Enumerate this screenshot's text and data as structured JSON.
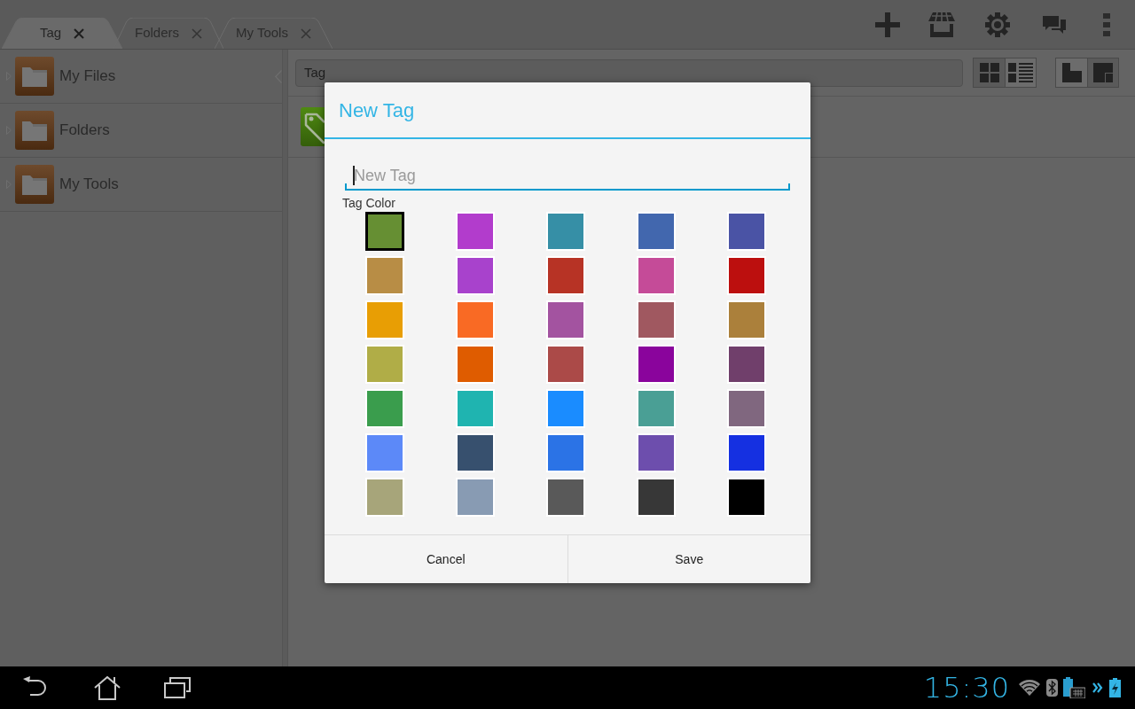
{
  "tabs": [
    {
      "label": "Tag",
      "selected": true
    },
    {
      "label": "Folders",
      "selected": false
    },
    {
      "label": "My Tools",
      "selected": false
    }
  ],
  "sidebar": {
    "items": [
      {
        "label": "My Files",
        "expanded": false
      },
      {
        "label": "Folders",
        "expanded": false
      },
      {
        "label": "My Tools",
        "expanded": false
      }
    ]
  },
  "search": {
    "value": "Tag"
  },
  "view_modes": [
    {
      "kind": "grid",
      "selected": false
    },
    {
      "kind": "list",
      "selected": true
    }
  ],
  "layout_modes": [
    {
      "kind": "single",
      "selected": true
    },
    {
      "kind": "split",
      "selected": false
    }
  ],
  "dialog": {
    "title": "New Tag",
    "name_field": {
      "placeholder": "New Tag"
    },
    "color_label": "Tag Color",
    "colors": [
      {
        "color": "#668f33",
        "selected": true
      },
      {
        "color": "#b23ccc",
        "selected": false
      },
      {
        "color": "#368fa6",
        "selected": false
      },
      {
        "color": "#4267ae",
        "selected": false
      },
      {
        "color": "#4a53a5",
        "selected": false
      },
      {
        "color": "#b88d45",
        "selected": false
      },
      {
        "color": "#a842cc",
        "selected": false
      },
      {
        "color": "#b73325",
        "selected": false
      },
      {
        "color": "#c54b98",
        "selected": false
      },
      {
        "color": "#bc0f0e",
        "selected": false
      },
      {
        "color": "#e89e04",
        "selected": false
      },
      {
        "color": "#f96a24",
        "selected": false
      },
      {
        "color": "#a353a0",
        "selected": false
      },
      {
        "color": "#a05860",
        "selected": false
      },
      {
        "color": "#ab803b",
        "selected": false
      },
      {
        "color": "#b0ad47",
        "selected": false
      },
      {
        "color": "#df5c00",
        "selected": false
      },
      {
        "color": "#ab4a48",
        "selected": false
      },
      {
        "color": "#8a049c",
        "selected": false
      },
      {
        "color": "#703f6b",
        "selected": false
      },
      {
        "color": "#3a9d4d",
        "selected": false
      },
      {
        "color": "#1fb4b0",
        "selected": false
      },
      {
        "color": "#1a8cff",
        "selected": false
      },
      {
        "color": "#4a9f95",
        "selected": false
      },
      {
        "color": "#80677f",
        "selected": false
      },
      {
        "color": "#5c89f8",
        "selected": false
      },
      {
        "color": "#37506e",
        "selected": false
      },
      {
        "color": "#2b73e6",
        "selected": false
      },
      {
        "color": "#6d4ead",
        "selected": false
      },
      {
        "color": "#1530e1",
        "selected": false
      },
      {
        "color": "#a7a57a",
        "selected": false
      },
      {
        "color": "#889bb3",
        "selected": false
      },
      {
        "color": "#595959",
        "selected": false
      },
      {
        "color": "#373737",
        "selected": false
      },
      {
        "color": "#000000",
        "selected": false
      }
    ],
    "buttons": [
      {
        "label": "Cancel"
      },
      {
        "label": "Save"
      }
    ]
  },
  "status_bar": {
    "time": "15:30"
  }
}
